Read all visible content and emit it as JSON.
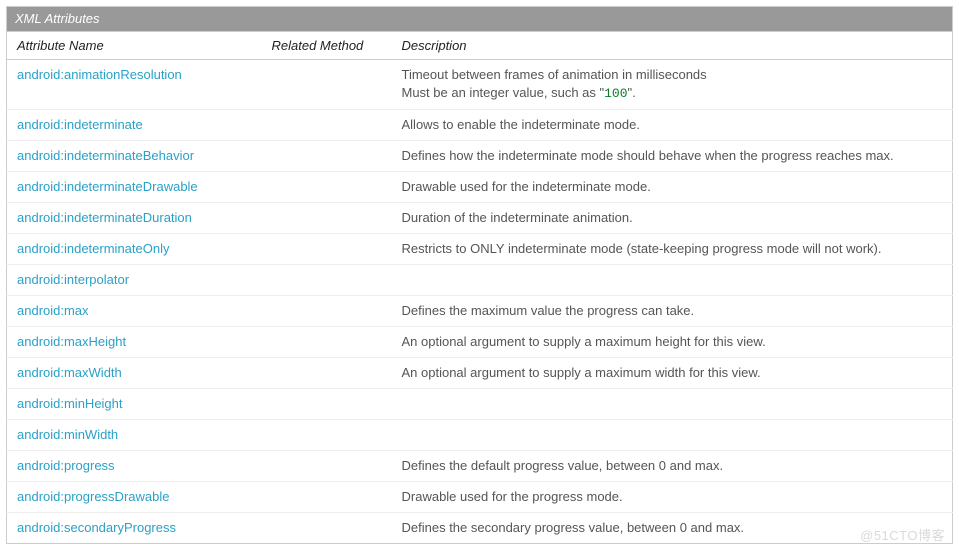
{
  "title": "XML Attributes",
  "headers": {
    "name": "Attribute Name",
    "method": "Related Method",
    "desc": "Description"
  },
  "code_sample": "100",
  "rows": [
    {
      "name": "android:animationResolution",
      "method": "",
      "desc_pre": "Timeout between frames of animation in milliseconds\nMust be an integer value, such as \"",
      "desc_post": "\"."
    },
    {
      "name": "android:indeterminate",
      "method": "",
      "desc": "Allows to enable the indeterminate mode."
    },
    {
      "name": "android:indeterminateBehavior",
      "method": "",
      "desc": "Defines how the indeterminate mode should behave when the progress reaches max."
    },
    {
      "name": "android:indeterminateDrawable",
      "method": "",
      "desc": "Drawable used for the indeterminate mode."
    },
    {
      "name": "android:indeterminateDuration",
      "method": "",
      "desc": "Duration of the indeterminate animation."
    },
    {
      "name": "android:indeterminateOnly",
      "method": "",
      "desc": "Restricts to ONLY indeterminate mode (state-keeping progress mode will not work)."
    },
    {
      "name": "android:interpolator",
      "method": "",
      "desc": ""
    },
    {
      "name": "android:max",
      "method": "",
      "desc": "Defines the maximum value the progress can take."
    },
    {
      "name": "android:maxHeight",
      "method": "",
      "desc": "An optional argument to supply a maximum height for this view."
    },
    {
      "name": "android:maxWidth",
      "method": "",
      "desc": "An optional argument to supply a maximum width for this view."
    },
    {
      "name": "android:minHeight",
      "method": "",
      "desc": ""
    },
    {
      "name": "android:minWidth",
      "method": "",
      "desc": ""
    },
    {
      "name": "android:progress",
      "method": "",
      "desc": "Defines the default progress value, between 0 and max."
    },
    {
      "name": "android:progressDrawable",
      "method": "",
      "desc": "Drawable used for the progress mode."
    },
    {
      "name": "android:secondaryProgress",
      "method": "",
      "desc": "Defines the secondary progress value, between 0 and max."
    }
  ],
  "watermark": "@51CTO博客"
}
